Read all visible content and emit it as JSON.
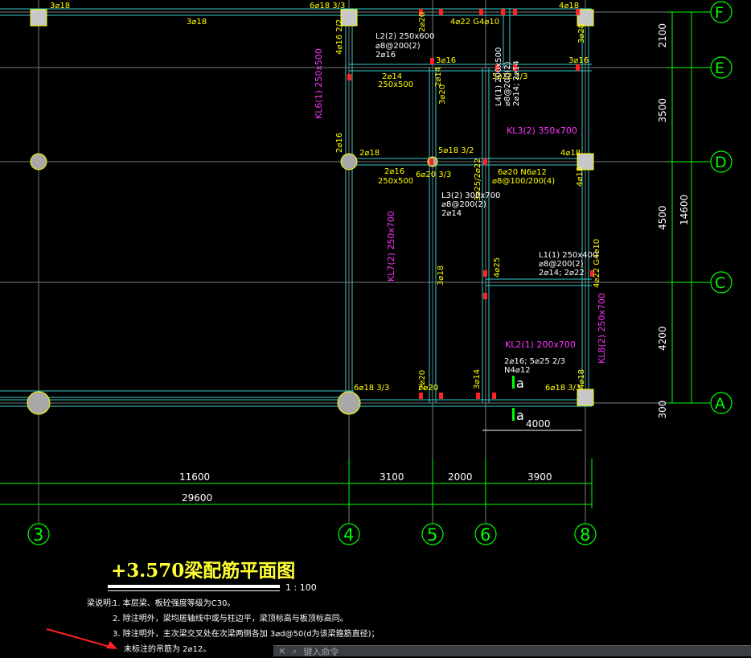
{
  "drawing": {
    "axes_vertical": [
      "3",
      "4",
      "5",
      "6",
      "8"
    ],
    "axes_horizontal": [
      "F",
      "E",
      "D",
      "C",
      "A"
    ],
    "dims_bottom_row1": [
      "11600",
      "3100",
      "2000",
      "3900"
    ],
    "dims_bottom_total": "29600",
    "dims_right": [
      "2100",
      "3500",
      "4500",
      "4200",
      "300"
    ],
    "dims_right_total": "14600",
    "dim_4000": "4000",
    "section_mark": "a",
    "beam_labels_yellow": [
      "3⌀18",
      "3⌀18",
      "6⌀18 3/3",
      "4⌀22 G4⌀10",
      "4⌀18",
      "4⌀16 2/2",
      "2⌀20",
      "3⌀20",
      "3⌀16",
      "3⌀16",
      "5⌀22 2/3",
      "2⌀14",
      "2⌀14",
      "250x500",
      "3⌀20",
      "2⌀16",
      "2⌀18",
      "5⌀18 3/2",
      "4⌀18",
      "2⌀16",
      "250x500",
      "6⌀20 3/3",
      "3⌀25/2⌀22",
      "6⌀20 N6⌀12",
      "⌀8@100/200(4)",
      "4⌀18",
      "3⌀18",
      "4⌀25",
      "4⌀22 G4⌀10",
      "2⌀20",
      "3⌀14",
      "6⌀18 3/3",
      "6⌀18 3/3",
      "2⌀20",
      "4⌀18"
    ],
    "beam_labels_white": [
      "L2(2) 250x600",
      "⌀8@200(2)",
      "2⌀16",
      "L3(2) 300x700",
      "⌀8@200(2)",
      "2⌀14",
      "L4(1) 200x500",
      "⌀8@200(2)",
      "2⌀14; 2⌀14",
      "L1(1) 250x400",
      "⌀8@200(2)",
      "2⌀14; 2⌀22",
      "2⌀16; 5⌀25 2/3",
      "N4⌀12"
    ],
    "beam_labels_magenta": [
      "KL6(1) 250x500",
      "KL3(2) 350x700",
      "KL7(2) 250x700",
      "KL2(1) 200x700",
      "KL8(2) 250x700"
    ]
  },
  "title": "+3.570梁配筋平面图",
  "scale": "1 : 100",
  "notes": {
    "label": "梁说明:",
    "items": [
      "1. 本层梁、板砼强度等级为C30。",
      "2. 除注明外，梁均居轴线中或与柱边平，梁顶标高与板顶标高同。",
      "3. 除注明外，主次梁交叉处在次梁两侧各加 3⌀d@50(d为该梁箍筋直径)；",
      "未标注的吊筋为 2⌀12。"
    ]
  },
  "commandbar": {
    "close": "✕",
    "search": "⌕",
    "prompt": "键入命令"
  },
  "colors": {
    "background": "#000000",
    "dimension": "#00ff00",
    "beam": "#33cccc",
    "label": "#ffff00",
    "magenta": "#ff33ff",
    "column": "#c8c8c8",
    "arrow": "#ff2222"
  }
}
